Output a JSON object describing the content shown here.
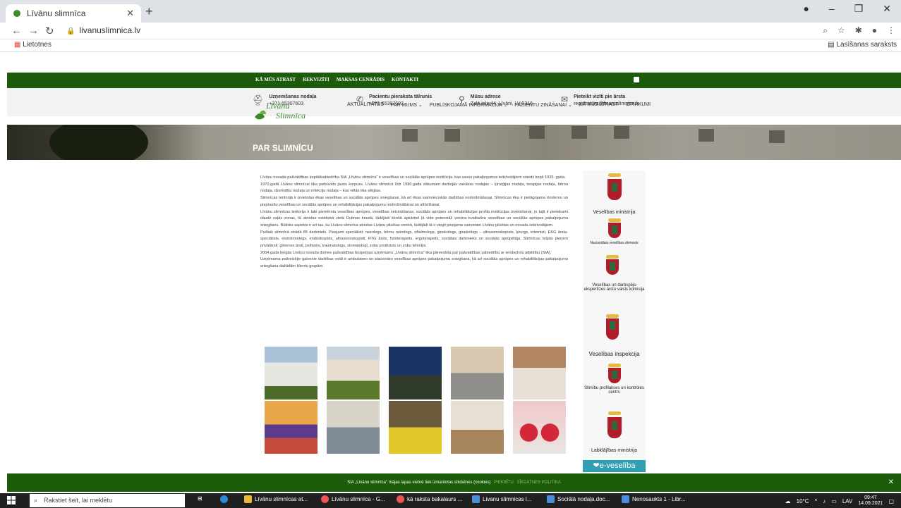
{
  "browser": {
    "tab_title": "Līvānu slimnīca",
    "url": "livanuslimnica.lv",
    "bookmark_apps": "Lietotnes",
    "reading_list": "Lasīšanas saraksts"
  },
  "topnav": [
    "KĀ MŪS ATRAST",
    "REKVIZĪTI",
    "MAKSAS CENRĀDIS",
    "KONTAKTI"
  ],
  "info": [
    {
      "title": "Uzņemšanas nodaļa",
      "value": "+371 65307603"
    },
    {
      "title": "Pacientu pieraksta tālrunis",
      "value": "+371 65307602"
    },
    {
      "title": "Mūsu adrese",
      "value": "Zaļā iela 44, Līvāni, LV-5316"
    },
    {
      "title": "Pieteikt vizīti pie ārsta",
      "value": "registratura@livanuslimnica.lv"
    }
  ],
  "logo": {
    "line1": "Līvānu",
    "line2": "Slimnīca",
    "prefix": "SIA"
  },
  "mainnav": [
    "AKTUALITĀTES",
    "PAR MUMS ⌄",
    "PUBLISKOJAMĀ INFORMĀCIJA ⌄",
    "PACIENTU ZINĀŠANAI ⌄",
    "KĀ MŪS ATRAST",
    "IEPIRKUMI"
  ],
  "hero_title": "PAR SLIMNĪCU",
  "content": [
    "Līvānu novada pašvaldības kapitālsabiedrība SIA „Līvānu slimnīca\" ir veselības un sociālās aprūpes institūcija, kas savus pakalpojumus iedzīvotājiem sniedz kopš 1933. gada.",
    "1970.gadā Līvānu slimnīcai tika piebūvēts jauns korpuss. Līvānu slimnīcā līdz 1990.gada sākumam darbojās vairākas nodaļas – ķirurģijas nodaļa, terapijas nodaļa, bērnu nodaļa, dzemdību nodaļa un infekciju nodaļa – kas vēlāk tika slēgtas.",
    "Slimnīcas teritorijā ir izvietotas ēkas veselības un sociālās aprūpes sniegšanai, kā arī ēkas saimnieciskās darbības nodrošināšanai. Slimnīcas ēka ir pielāgojama modernu un pieprasītu veselības un sociālās aprūpes un rehabilitācijas pakalpojumu nodrošināšanai un attīstīšanai.",
    "Līvānu slimnīcas teritorija ir labi piemērota veselības aprūpes, veselības veicināšanas, sociālās aprūpes un rehabilitācijas profila institūcijas izvietošanai, jo tajā ir pietiekami daudz zaļās zonas, tā atrodas estētiskā vietā Dubnas krastā, tādējādi ēkošā apkārtnē ļā vide potenciāli veicina kvalitatīvu veselības un sociālās aprūpes pakalpojumu sniegšanu. Būtisks aspekts ir arī tas, ka Līvānu slimnīca atrodas Līvānu pilsētas centrā, tādējādi tā ir viegli pieejama vairumam Līvānu pilsētas un novada iedzīvotājiem.",
    "Pašlaik slimnīcā strādā 85 darbinieki. Pieejami speciālisti: neirologs, bērnu neirologs, oftalmologs, ginekologs, ginekologs – ultrasonoskopists, ķirurgs, internisti, EKG ārsta-speciālists, endokrinologs, endoskopists, ultrasonoskopisti, RTG ārsts, fizioterapeits, ergoterapeits, sociālais darbinieks un sociālās aprūpētāja. Slimnīcas telpās pieņem privātārsti: ģimenes ārsti, psihiatrs, traumatologs, stomatologi, zobu protēzists un zobu tehniķis.",
    "2004.gada beigās Līvānu novada domes pašvaldības bezpeļņas uzņēmums „Līvānu slimnīca\" tika pārveidota par pašvaldības sabiedrību ar ierobežotu atbildību (SIA).",
    "Uzņēmuma pašreizējie galvenie darbības veidi ir ambulatoro un stacionāro veselības aprūpes pakalpojumu sniegšana, kā arī sociālās aprūpes un rehabilitācijas pakalpojumu sniegšana dažādām klientu grupām."
  ],
  "agencies": [
    "Veselības ministrija",
    "Nacionālais veselības dienests",
    "Veselības un darbspēju ekspertīzes ārstu valsts komisija",
    "Veselības inspekcija",
    "Slimību profilakses un kontroles centrs",
    "Labklājības ministrija"
  ],
  "evesel": "e-veselība",
  "cookie": {
    "text": "SIA „Līvānu slimnīca\" mājas lapas vietnē tiek izmantotas sīkdatnes (cookies)",
    "accept": "PIEKRĪTU",
    "policy": "SĪKDATNES POLITIKA"
  },
  "taskbar": {
    "search": "Rakstiet šeit, lai meklētu",
    "items": [
      "Līvānu slimnīcas at...",
      "Līvānu slimnīca - G...",
      "kā raksta bakalaurs ...",
      "Livanu slimnicas l...",
      "Sociālā nodaļa.doc...",
      "Nenosaukts 1 - Libr..."
    ],
    "weather": "10°C",
    "lang": "LAV",
    "time": "09:47",
    "date": "14.09.2021"
  }
}
